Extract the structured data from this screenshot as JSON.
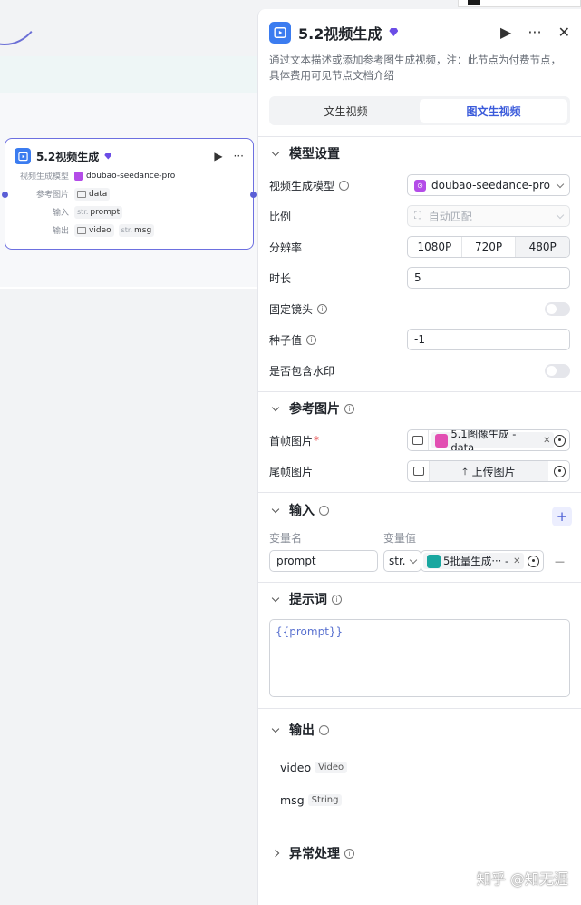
{
  "canvas": {
    "node": {
      "title": "5.2视频生成",
      "rows": [
        {
          "key": "视频生成模型",
          "chips": [
            {
              "type": "",
              "text": "doubao-seedance-pro"
            }
          ]
        },
        {
          "key": "参考图片",
          "chips": [
            {
              "type": "",
              "text": "data"
            }
          ]
        },
        {
          "key": "输入",
          "chips": [
            {
              "type": "str.",
              "text": "prompt"
            }
          ]
        },
        {
          "key": "输出",
          "chips": [
            {
              "type": "",
              "text": "video"
            },
            {
              "type": "str.",
              "text": "msg"
            }
          ]
        }
      ]
    }
  },
  "panel": {
    "title": "5.2视频生成",
    "description": "通过文本描述或添加参考图生成视频，注：此节点为付费节点，具体费用可见节点文档介绍",
    "tabs": [
      {
        "label": "文生视频",
        "active": false
      },
      {
        "label": "图文生视频",
        "active": true
      }
    ],
    "model_section": {
      "title": "模型设置",
      "model_label": "视频生成模型",
      "model_value": "doubao-seedance-pro",
      "ratio_label": "比例",
      "ratio_value": "自动匹配",
      "resolution_label": "分辨率",
      "resolutions": [
        "1080P",
        "720P",
        "480P"
      ],
      "resolution_selected": "480P",
      "duration_label": "时长",
      "duration_value": "5",
      "fixed_camera_label": "固定镜头",
      "seed_label": "种子值",
      "seed_value": "-1",
      "watermark_label": "是否包含水印"
    },
    "ref_section": {
      "title": "参考图片",
      "first_label": "首帧图片",
      "first_required_mark": "*",
      "first_value": "5.1图像生成 - data",
      "last_label": "尾帧图片",
      "upload_label": "上传图片"
    },
    "input_section": {
      "title": "输入",
      "col_name": "变量名",
      "col_value": "变量值",
      "var_name": "prompt",
      "var_type": "str.",
      "var_ref": "5批量生成··· -",
      "add_symbol": "+",
      "remove_symbol": "—"
    },
    "prompt_section": {
      "title": "提示词",
      "value": "{{prompt}}"
    },
    "output_section": {
      "title": "输出",
      "items": [
        {
          "name": "video",
          "type": "Video"
        },
        {
          "name": "msg",
          "type": "String"
        }
      ]
    },
    "error_section": {
      "title": "异常处理"
    }
  },
  "watermark": "知乎 @知无涯",
  "colors": {
    "accent": "#3b5bdb",
    "node_border": "#6d70e0",
    "video_icon": "#3b7cf0"
  }
}
